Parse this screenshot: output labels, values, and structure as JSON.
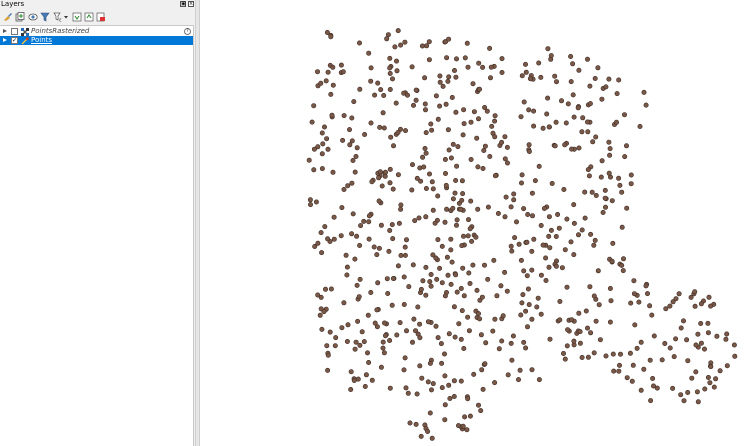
{
  "panel": {
    "title": "Layers",
    "float_button": "▣",
    "close_button": "×"
  },
  "toolbar": {
    "tools": [
      "open-layer-styling-icon",
      "add-group-icon",
      "manage-map-themes-icon",
      "filter-legend-icon",
      "filter-by-expression-icon",
      "expand-all-icon",
      "collapse-all-icon",
      "remove-layer-icon"
    ]
  },
  "layers": [
    {
      "name": "PointsRasterized",
      "checked": false,
      "expanded": false,
      "type": "raster",
      "selected": false,
      "help": "?"
    },
    {
      "name": "Points",
      "checked": true,
      "expanded": false,
      "type": "point",
      "selected": true
    }
  ],
  "map": {
    "point_fill": "#7a5848",
    "point_stroke": "#3d2c24",
    "background": "#ffffff"
  },
  "colors": {
    "selection": "#0078d7",
    "panel_bg": "#f0f0f0"
  }
}
